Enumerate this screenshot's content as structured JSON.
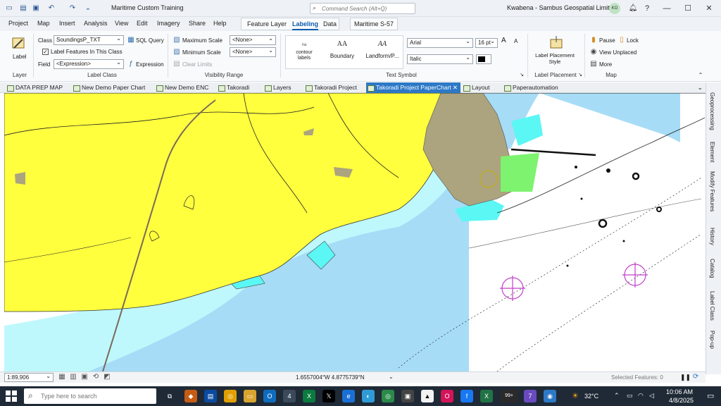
{
  "title_bar": {
    "app_title": "Maritime Custom Training",
    "search_placeholder": "Command Search (Alt+Q)",
    "user": "Kwabena - Sambus Geospatial Limited",
    "avatar_initials": "KO",
    "help": "?",
    "minimize": "—",
    "maximize": "☐",
    "close": "✕"
  },
  "menu": {
    "tabs": [
      "Project",
      "Map",
      "Insert",
      "Analysis",
      "View",
      "Edit",
      "Imagery",
      "Share",
      "Help"
    ],
    "context_tabs": [
      "Feature Layer",
      "Labeling",
      "Data"
    ],
    "active_tab": "Labeling",
    "maritime_tab": "Maritime S-57"
  },
  "ribbon": {
    "layer_group": {
      "label_button": "Label",
      "group_label": "Layer"
    },
    "label_class_group": {
      "class_label": "Class",
      "class_value": "SoundingsP_TXT",
      "sql_query": "SQL Query",
      "label_features": "Label Features In This Class",
      "field_label": "Field",
      "field_value": "<Expression>",
      "expression": "Expression",
      "group_label": "Label Class"
    },
    "visibility_group": {
      "max_scale": "Maximum Scale",
      "max_value": "<None>",
      "min_scale": "Minimum Scale",
      "min_value": "<None>",
      "clear_limits": "Clear Limits",
      "group_label": "Visibility Range"
    },
    "text_symbol_group": {
      "gallery": [
        {
          "icon": "na",
          "label": "contour labels"
        },
        {
          "icon": "AA",
          "label": "Boundary"
        },
        {
          "icon": "AA",
          "label": "Landform/P..."
        }
      ],
      "font": "Arial",
      "size": "16 pt",
      "style": "Italic",
      "grow": "A",
      "shrink": "A",
      "group_label": "Text Symbol"
    },
    "placement_group": {
      "label": "Label Placement Style",
      "group_label": "Label Placement"
    },
    "map_group": {
      "pause": "Pause",
      "lock": "Lock",
      "view_unplaced": "View Unplaced",
      "more": "More",
      "group_label": "Map"
    }
  },
  "doc_tabs": [
    {
      "label": "DATA PREP MAP",
      "active": false
    },
    {
      "label": "New Demo Paper Chart",
      "active": false
    },
    {
      "label": "New Demo ENC",
      "active": false
    },
    {
      "label": "Takoradi",
      "active": false
    },
    {
      "label": "Layers",
      "active": false
    },
    {
      "label": "Takoradi Project",
      "active": false
    },
    {
      "label": "Takoradi Project PaperChart",
      "active": true
    },
    {
      "label": "Layout",
      "active": false
    },
    {
      "label": "Paperautomation",
      "active": false
    }
  ],
  "dock_panes": [
    "Geoprocessing",
    "Element",
    "Modify Features",
    "History",
    "Catalog",
    "Label Class",
    "Pop-up"
  ],
  "status_bar": {
    "scale": "1:89,906",
    "coordinates": "1.6557004°W 4.8775739°N",
    "selected_features": "Selected Features: 0",
    "pause": "❚❚"
  },
  "taskbar": {
    "search_placeholder": "Type here to search",
    "badge_4": "4",
    "badge_99": "99+",
    "badge_7": "7",
    "temperature": "32°C",
    "time": "10:06 AM",
    "date": "4/8/2025"
  },
  "colors": {
    "land": "#ffff3e",
    "shallow": "#bef8fc",
    "water": "#a6dcf6",
    "built": "#aba47e",
    "cyan": "#5af7f4",
    "accent": "#2d79c7"
  }
}
